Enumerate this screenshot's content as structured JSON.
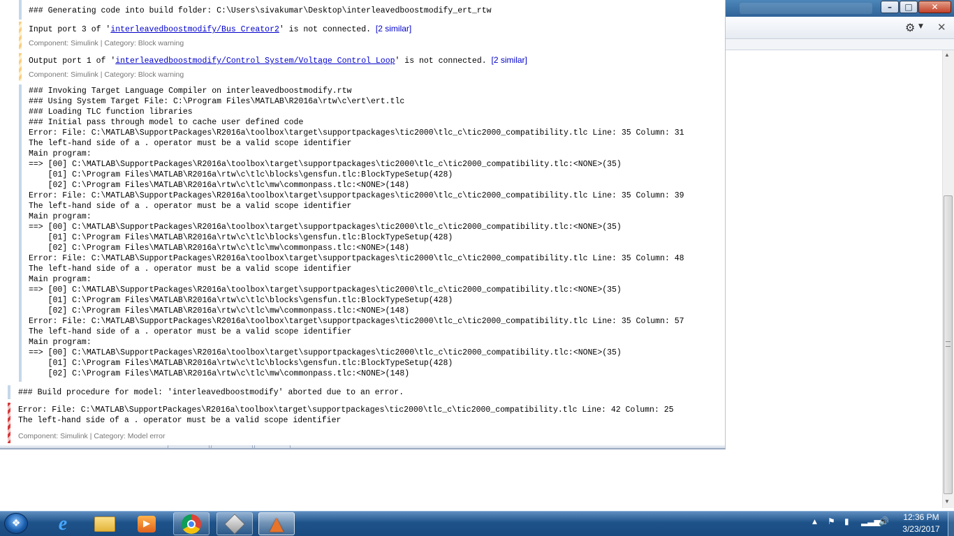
{
  "diagnostics": {
    "info1": "### Generating code into build folder: C:\\Users\\sivakumar\\Desktop\\interleavedboostmodify_ert_rtw",
    "warn1": {
      "prefix": "Input port 3 of '",
      "link": "interleavedboostmodify/Bus Creator2",
      "suffix": "' is not connected.",
      "similar": "[2 similar]",
      "meta": "Component: Simulink | Category: Block warning"
    },
    "warn2": {
      "prefix": "Output port 1 of '",
      "link": "interleavedboostmodify/Control System/Voltage Control Loop",
      "suffix": "' is not connected.",
      "similar": "[2 similar]",
      "meta": "Component: Simulink | Category: Block warning"
    },
    "tlc_log": [
      "### Invoking Target Language Compiler on interleavedboostmodify.rtw",
      "### Using System Target File: C:\\Program Files\\MATLAB\\R2016a\\rtw\\c\\ert\\ert.tlc",
      "### Loading TLC function libraries",
      "### Initial pass through model to cache user defined code",
      "Error: File: C:\\MATLAB\\SupportPackages\\R2016a\\toolbox\\target\\supportpackages\\tic2000\\tlc_c\\tic2000_compatibility.tlc Line: 35 Column: 31",
      "The left-hand side of a . operator must be a valid scope identifier",
      "Main program:",
      "==> [00] C:\\MATLAB\\SupportPackages\\R2016a\\toolbox\\target\\supportpackages\\tic2000\\tlc_c\\tic2000_compatibility.tlc:<NONE>(35)",
      "    [01] C:\\Program Files\\MATLAB\\R2016a\\rtw\\c\\tlc\\blocks\\gensfun.tlc:BlockTypeSetup(428)",
      "    [02] C:\\Program Files\\MATLAB\\R2016a\\rtw\\c\\tlc\\mw\\commonpass.tlc:<NONE>(148)",
      "Error: File: C:\\MATLAB\\SupportPackages\\R2016a\\toolbox\\target\\supportpackages\\tic2000\\tlc_c\\tic2000_compatibility.tlc Line: 35 Column: 39",
      "The left-hand side of a . operator must be a valid scope identifier",
      "Main program:",
      "==> [00] C:\\MATLAB\\SupportPackages\\R2016a\\toolbox\\target\\supportpackages\\tic2000\\tlc_c\\tic2000_compatibility.tlc:<NONE>(35)",
      "    [01] C:\\Program Files\\MATLAB\\R2016a\\rtw\\c\\tlc\\blocks\\gensfun.tlc:BlockTypeSetup(428)",
      "    [02] C:\\Program Files\\MATLAB\\R2016a\\rtw\\c\\tlc\\mw\\commonpass.tlc:<NONE>(148)",
      "Error: File: C:\\MATLAB\\SupportPackages\\R2016a\\toolbox\\target\\supportpackages\\tic2000\\tlc_c\\tic2000_compatibility.tlc Line: 35 Column: 48",
      "The left-hand side of a . operator must be a valid scope identifier",
      "Main program:",
      "==> [00] C:\\MATLAB\\SupportPackages\\R2016a\\toolbox\\target\\supportpackages\\tic2000\\tlc_c\\tic2000_compatibility.tlc:<NONE>(35)",
      "    [01] C:\\Program Files\\MATLAB\\R2016a\\rtw\\c\\tlc\\blocks\\gensfun.tlc:BlockTypeSetup(428)",
      "    [02] C:\\Program Files\\MATLAB\\R2016a\\rtw\\c\\tlc\\mw\\commonpass.tlc:<NONE>(148)",
      "Error: File: C:\\MATLAB\\SupportPackages\\R2016a\\toolbox\\target\\supportpackages\\tic2000\\tlc_c\\tic2000_compatibility.tlc Line: 35 Column: 57",
      "The left-hand side of a . operator must be a valid scope identifier",
      "Main program:",
      "==> [00] C:\\MATLAB\\SupportPackages\\R2016a\\toolbox\\target\\supportpackages\\tic2000\\tlc_c\\tic2000_compatibility.tlc:<NONE>(35)",
      "    [01] C:\\Program Files\\MATLAB\\R2016a\\rtw\\c\\tlc\\blocks\\gensfun.tlc:BlockTypeSetup(428)",
      "    [02] C:\\Program Files\\MATLAB\\R2016a\\rtw\\c\\tlc\\mw\\commonpass.tlc:<NONE>(148)"
    ],
    "build_aborted": "### Build procedure for model: 'interleavedboostmodify' aborted due to an error.",
    "final_error": {
      "line1": "Error: File: C:\\MATLAB\\SupportPackages\\R2016a\\toolbox\\target\\supportpackages\\tic2000\\tlc_c\\tic2000_compatibility.tlc Line: 42 Column: 25",
      "line2": "The left-hand side of a . operator must be a valid scope identifier",
      "meta": "Component: Simulink | Category: Model error"
    }
  },
  "taskbar": {
    "apps": [
      {
        "name": "internet-explorer",
        "glyph": "e",
        "color": "#2f8ee0"
      },
      {
        "name": "file-explorer",
        "glyph": "▤",
        "color": "#f0c64a"
      },
      {
        "name": "media-player",
        "glyph": "▶",
        "color": "#f08a24"
      },
      {
        "name": "chrome",
        "glyph": "●",
        "color": "#dd4b39"
      },
      {
        "name": "cube-app",
        "glyph": "▦",
        "color": "#d8d8d8"
      },
      {
        "name": "matlab",
        "glyph": "▲",
        "color": "#e8742a"
      }
    ],
    "tray_icons": [
      "show-hidden-icons",
      "flag-icon",
      "power-icon",
      "network-icon",
      "volume-icon"
    ],
    "time": "12:36 PM",
    "date": "3/23/2017"
  },
  "colors": {
    "info_bar": "#c5d7ea",
    "warning_bar": "#f7cf84",
    "error_bar": "#d33a3a",
    "link": "#0000cc"
  }
}
